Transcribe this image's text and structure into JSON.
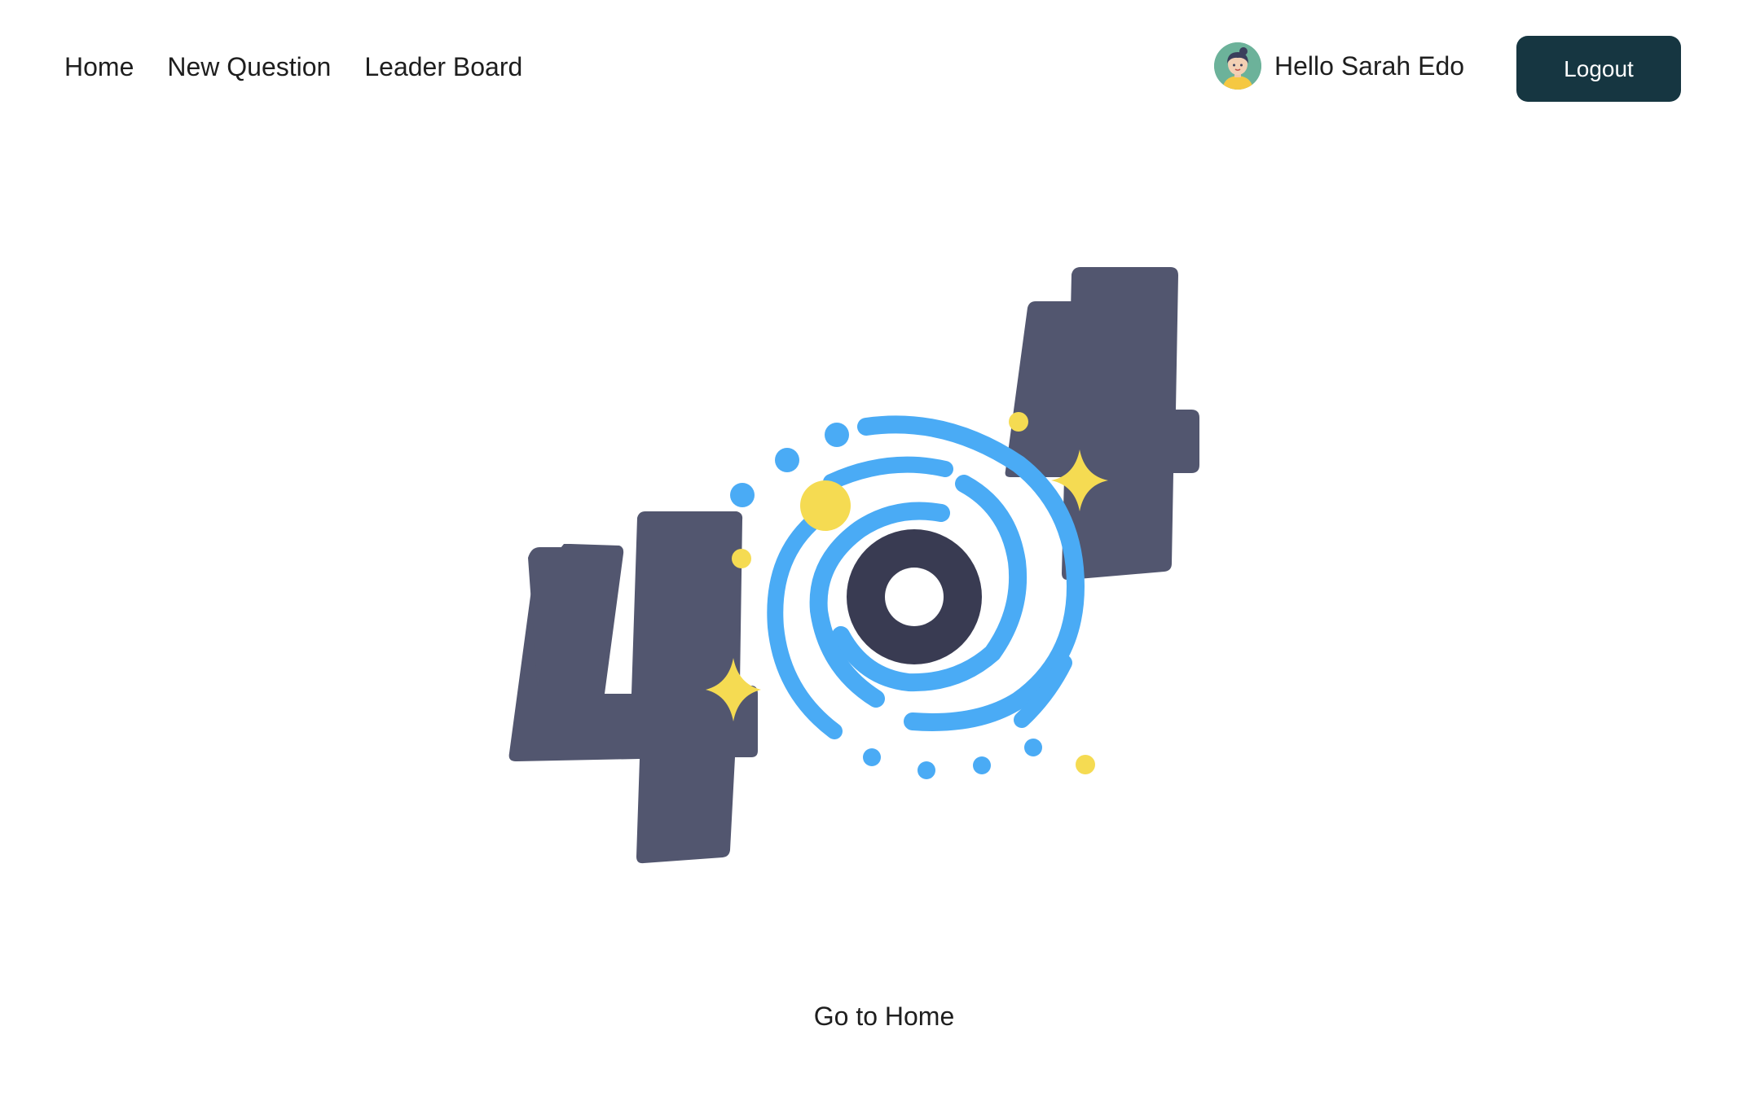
{
  "nav": {
    "items": [
      {
        "label": "Home"
      },
      {
        "label": "New Question"
      },
      {
        "label": "Leader Board"
      }
    ]
  },
  "user": {
    "greeting": "Hello Sarah Edo",
    "avatar_icon": "user-avatar-icon"
  },
  "actions": {
    "logout_label": "Logout",
    "go_home_label": "Go to Home"
  },
  "illustration": {
    "icon": "404-illustration",
    "colors": {
      "digit": "#52566f",
      "orbit": "#4aabf5",
      "core": "#393b52",
      "star": "#f5db52"
    }
  },
  "colors": {
    "logout_bg": "#163641",
    "text": "#1e1e1e"
  }
}
